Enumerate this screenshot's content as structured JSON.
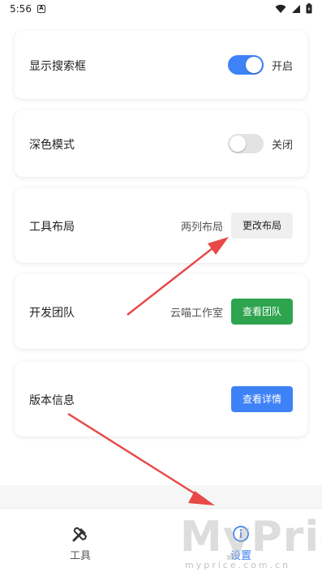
{
  "status_bar": {
    "time": "5:56",
    "notif_glyph": "A"
  },
  "settings": {
    "search_box": {
      "label": "显示搜索框",
      "state": "开启",
      "enabled": true
    },
    "dark_mode": {
      "label": "深色模式",
      "state": "关闭",
      "enabled": false
    },
    "tool_layout": {
      "label": "工具布局",
      "value": "两列布局",
      "button": "更改布局"
    },
    "dev_team": {
      "label": "开发团队",
      "value": "云喵工作室",
      "button": "查看团队"
    },
    "version": {
      "label": "版本信息",
      "button": "查看详情"
    }
  },
  "tabbar": {
    "tools": {
      "label": "工具",
      "icon": "tools-icon"
    },
    "settings": {
      "label": "设置",
      "icon": "info-icon",
      "active": true
    }
  },
  "watermark": {
    "brand": "MyPrice",
    "domain": "myprice.com.cn"
  },
  "colors": {
    "accent": "#3e82f7",
    "green": "#2ea44f",
    "arrow": "#e84848"
  }
}
